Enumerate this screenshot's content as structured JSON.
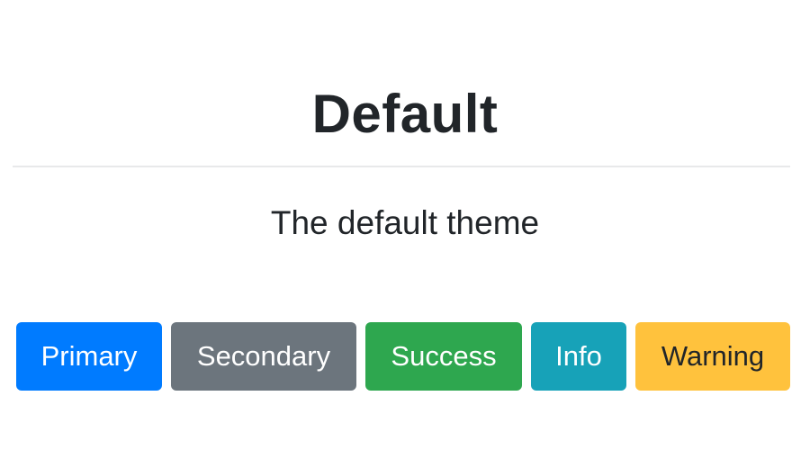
{
  "page": {
    "title": "Default",
    "subtitle": "The default theme"
  },
  "buttons": {
    "primary": "Primary",
    "secondary": "Secondary",
    "success": "Success",
    "info": "Info",
    "warning": "Warning"
  },
  "colors": {
    "primary": "#007bff",
    "secondary": "#6c757d",
    "success": "#2ea74f",
    "info": "#17a2b8",
    "warning": "#ffc23d",
    "text": "#212529"
  }
}
